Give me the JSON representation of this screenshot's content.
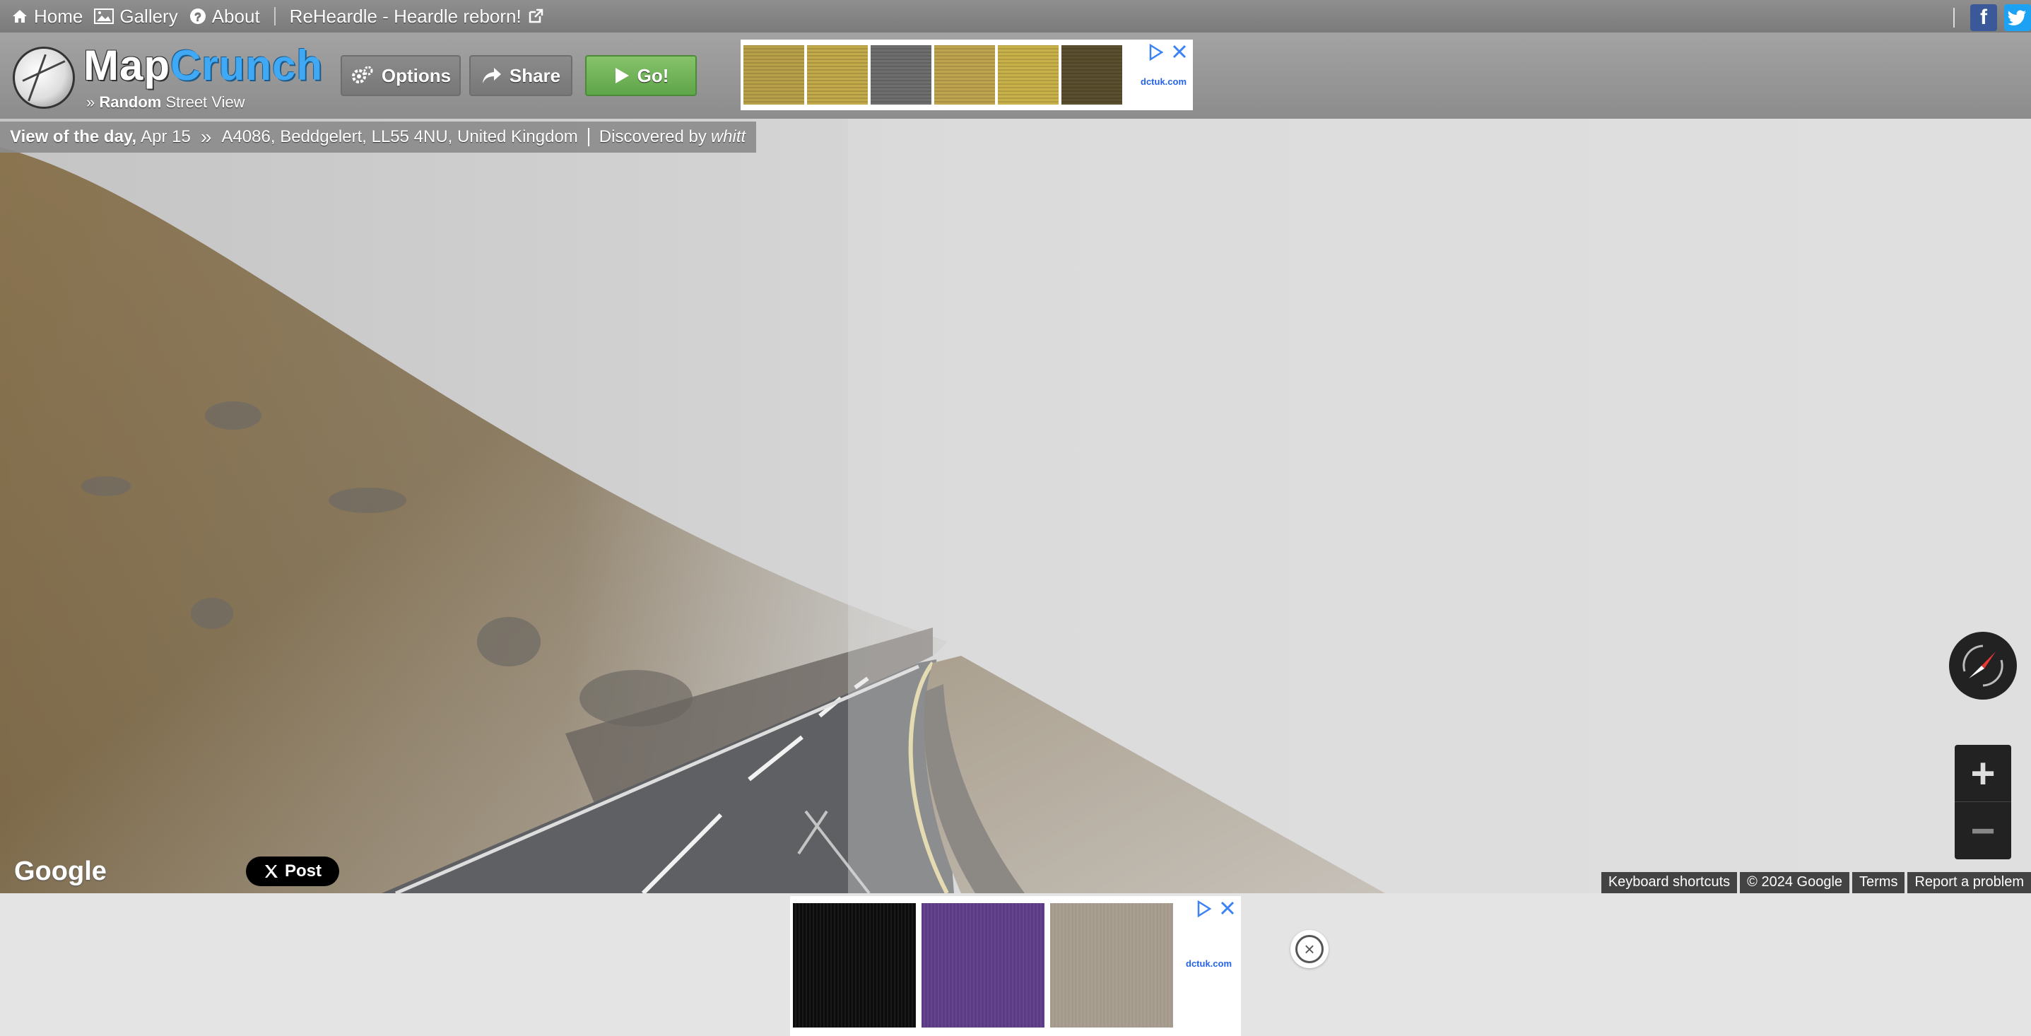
{
  "nav": {
    "home": "Home",
    "gallery": "Gallery",
    "about": "About",
    "promo": "ReHeardle - Heardle reborn!"
  },
  "logo": {
    "map": "Map",
    "crunch": "Crunch",
    "sub_prefix": "» ",
    "sub_bold": "Random",
    "sub_rest": " Street View"
  },
  "toolbar": {
    "options": "Options",
    "share": "Share",
    "go": "Go!"
  },
  "ads": {
    "brand": "dctuk.com",
    "top_swatches": [
      "#b8a04a",
      "#c2a94a",
      "#6e6e6e",
      "#bfa44f",
      "#c9b14a",
      "#5a5030"
    ],
    "bottom_swatches": [
      "#0c0c0c",
      "#5b3b86",
      "#a49a8c"
    ]
  },
  "infobar": {
    "label": "View of the day,",
    "date": "Apr 15",
    "arrow": "»",
    "location": "A4086, Beddgelert, LL55 4NU, United Kingdom",
    "discovered": "Discovered by",
    "user": "whitt"
  },
  "map": {
    "google": "Google",
    "post": "Post",
    "watermark": "© 2024 Google",
    "attribution": [
      "Keyboard shortcuts",
      "© 2024 Google",
      "Terms",
      "Report a problem"
    ]
  },
  "icons": {
    "home": "home-icon",
    "gallery": "image-icon",
    "about": "question-icon",
    "external": "external-link-icon",
    "facebook": "facebook-icon",
    "twitter": "twitter-icon"
  }
}
